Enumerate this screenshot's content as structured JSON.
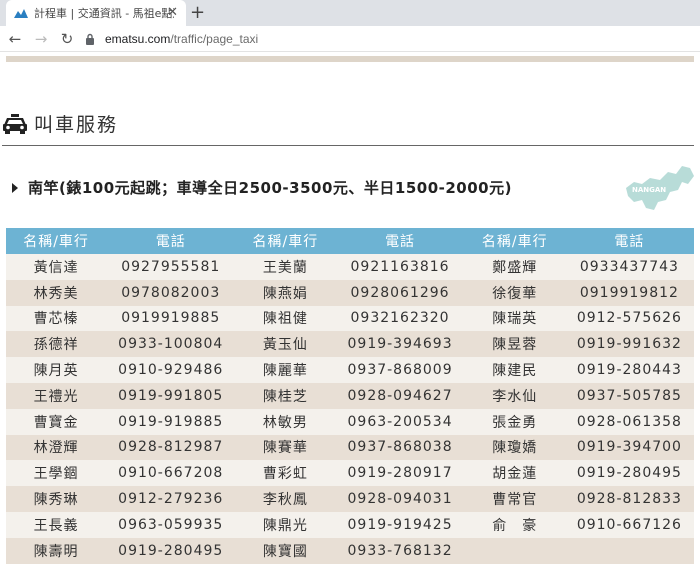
{
  "browser": {
    "tab_title": "計程車 | 交通資訊 - 馬祖e點通",
    "tab_close": "✕",
    "new_tab": "+",
    "url_host": "ematsu.com",
    "url_path": "/traffic/page_taxi"
  },
  "page": {
    "heading": "叫車服務",
    "subheading": "南竿(錶100元起跳；車導全日2500-3500元、半日1500-2000元)",
    "map_label": "NANGAN"
  },
  "table": {
    "headers": [
      "名稱/車行",
      "電話",
      "名稱/車行",
      "電話",
      "名稱/車行",
      "電話"
    ],
    "rows": [
      [
        "黃信達",
        "0927955581",
        "王美蘭",
        "0921163816",
        "鄭盛輝",
        "0933437743"
      ],
      [
        "林秀美",
        "0978082003",
        "陳燕娟",
        "0928061296",
        "徐復華",
        "0919919812"
      ],
      [
        "曹芯榛",
        "0919919885",
        "陳祖健",
        "0932162320",
        "陳瑞英",
        "0912-575626"
      ],
      [
        "孫德祥",
        "0933-100804",
        "黃玉仙",
        "0919-394693",
        "陳昱蓉",
        "0919-991632"
      ],
      [
        "陳月英",
        "0910-929486",
        "陳麗華",
        "0937-868009",
        "陳建民",
        "0919-280443"
      ],
      [
        "王禮光",
        "0919-991805",
        "陳桂芝",
        "0928-094627",
        "李水仙",
        "0937-505785"
      ],
      [
        "曹寶金",
        "0919-919885",
        "林敏男",
        "0963-200534",
        "張金勇",
        "0928-061358"
      ],
      [
        "林澄輝",
        "0928-812987",
        "陳賽華",
        "0937-868038",
        "陳瓊嬌",
        "0919-394700"
      ],
      [
        "王學錮",
        "0910-667208",
        "曹彩虹",
        "0919-280917",
        "胡金蓮",
        "0919-280495"
      ],
      [
        "陳秀琳",
        "0912-279236",
        "李秋鳳",
        "0928-094031",
        "曹常官",
        "0928-812833"
      ],
      [
        "王長義",
        "0963-059935",
        "陳鼎光",
        "0919-919425",
        "俞　豪",
        "0910-667126"
      ],
      [
        "陳壽明",
        "0919-280495",
        "陳寶國",
        "0933-768132",
        "",
        ""
      ]
    ]
  },
  "colors": {
    "header_bg": "#6db3d3",
    "row_light": "#f4f1ec",
    "row_dark": "#e8dfd5",
    "topbar": "#ded5c9"
  }
}
